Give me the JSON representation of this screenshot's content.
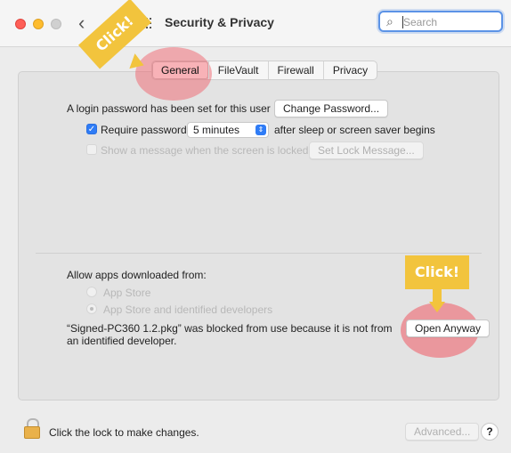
{
  "window": {
    "title": "Security & Privacy",
    "search_placeholder": "Search",
    "back_icon": "chevron-left-icon",
    "grid_icon": "grid-icon"
  },
  "tabs": [
    {
      "label": "General",
      "active": true
    },
    {
      "label": "FileVault",
      "active": false
    },
    {
      "label": "Firewall",
      "active": false
    },
    {
      "label": "Privacy",
      "active": false
    }
  ],
  "general": {
    "login_password_text": "A login password has been set for this user",
    "change_password_label": "Change Password...",
    "require_password_label": "Require password",
    "require_password_checked": true,
    "require_password_value": "5 minutes",
    "after_sleep_text": "after sleep or screen saver begins",
    "show_message_label": "Show a message when the screen is locked",
    "show_message_checked": false,
    "set_lock_message_label": "Set Lock Message..."
  },
  "downloads": {
    "allow_apps_label": "Allow apps downloaded from:",
    "options": [
      {
        "label": "App Store",
        "selected": false
      },
      {
        "label": "App Store and identified developers",
        "selected": true
      }
    ],
    "blocked_message_line1": "“Signed-PC360 1.2.pkg” was blocked from use because it is not from",
    "blocked_message_line2": "an identified developer.",
    "open_anyway_label": "Open Anyway"
  },
  "footer": {
    "lock_text": "Click the lock to make changes.",
    "advanced_label": "Advanced...",
    "help_label": "?"
  },
  "annotations": {
    "callout_general": "Click!",
    "callout_open_anyway": "Click!",
    "highlight_color": "#f05a64",
    "callout_color": "#f2c43d"
  }
}
